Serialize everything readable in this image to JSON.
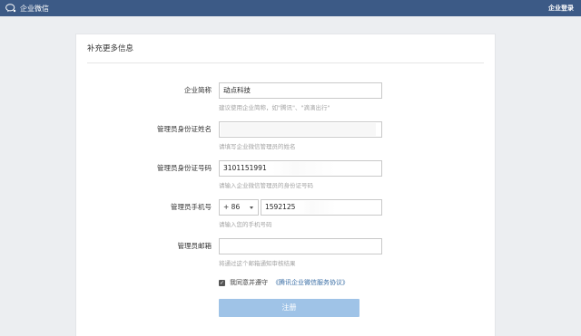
{
  "topbar": {
    "brand": "企业微信",
    "login": "企业登录"
  },
  "card": {
    "title": "补充更多信息"
  },
  "form": {
    "company": {
      "label": "企业简称",
      "value": "动点科技",
      "hint": "建议使用企业简称，如\"腾讯\"、\"滴滴出行\""
    },
    "admin_name": {
      "label": "管理员身份证姓名",
      "value": "",
      "hint": "请填写企业微信管理员的姓名"
    },
    "admin_id": {
      "label": "管理员身份证号码",
      "value": "3101151991",
      "hint": "请输入企业微信管理员的身份证号码"
    },
    "admin_phone": {
      "label": "管理员手机号",
      "country_code": "+ 86",
      "value": "1592125",
      "hint": "请输入您的手机号码"
    },
    "admin_email": {
      "label": "管理员邮箱",
      "value": "",
      "hint": "将通过这个邮箱通知审核结果"
    },
    "agreement": {
      "checked": true,
      "prefix": "我同意并遵守",
      "link": "《腾讯企业微信服务协议》"
    },
    "submit_label": "注册"
  },
  "colors": {
    "topbar": "#3c5a86",
    "submit": "#9fc3e7",
    "link": "#3a6ea5"
  }
}
